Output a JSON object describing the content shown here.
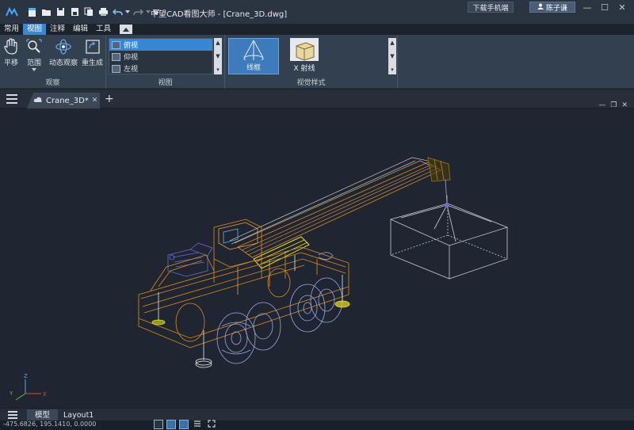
{
  "window": {
    "title": "中望CAD看图大师 - [Crane_3D.dwg]",
    "download_label": "下载手机端",
    "user_name": "陈子谦",
    "minimize": "—",
    "maximize": "☐",
    "close": "✕"
  },
  "menu": {
    "tabs": [
      {
        "label": "常用"
      },
      {
        "label": "视图"
      },
      {
        "label": "注释"
      },
      {
        "label": "编辑"
      },
      {
        "label": "工具"
      }
    ],
    "active_tab": "视图"
  },
  "ribbon": {
    "observe": {
      "buttons": [
        {
          "label": "平移",
          "icon": "hand-icon"
        },
        {
          "label": "范围",
          "icon": "zoom-extents-icon"
        },
        {
          "label": "动态观察",
          "icon": "orbit-icon"
        },
        {
          "label": "重生成",
          "icon": "regen-icon"
        }
      ],
      "group_label": "观察"
    },
    "views": {
      "items": [
        {
          "label": "俯视",
          "selected": true
        },
        {
          "label": "仰视",
          "selected": false
        },
        {
          "label": "左视",
          "selected": false
        }
      ],
      "group_label": "视图"
    },
    "visual_styles": {
      "items": [
        {
          "label": "线框",
          "selected": true,
          "icon": "wireframe-cone-icon"
        },
        {
          "label": "X 射线",
          "selected": false,
          "icon": "xray-cube-icon"
        }
      ],
      "group_label": "视觉样式"
    }
  },
  "document": {
    "tab_label": "Crane_3D*",
    "close_glyph": "✕",
    "add_glyph": "+"
  },
  "layouts": {
    "tabs": [
      {
        "label": "模型",
        "active": true
      },
      {
        "label": "Layout1",
        "active": false
      }
    ]
  },
  "status": {
    "coordinates": "-475.6826, 195.1410, 0.0000"
  },
  "colors": {
    "accent": "#3a86d6",
    "crane_body": "#e08a1e",
    "boom_highlight": "#e8e020",
    "hydraulics": "#6a6ad8",
    "wheels": "#9aa8e8",
    "wireframe_box": "#c8ccd4"
  }
}
